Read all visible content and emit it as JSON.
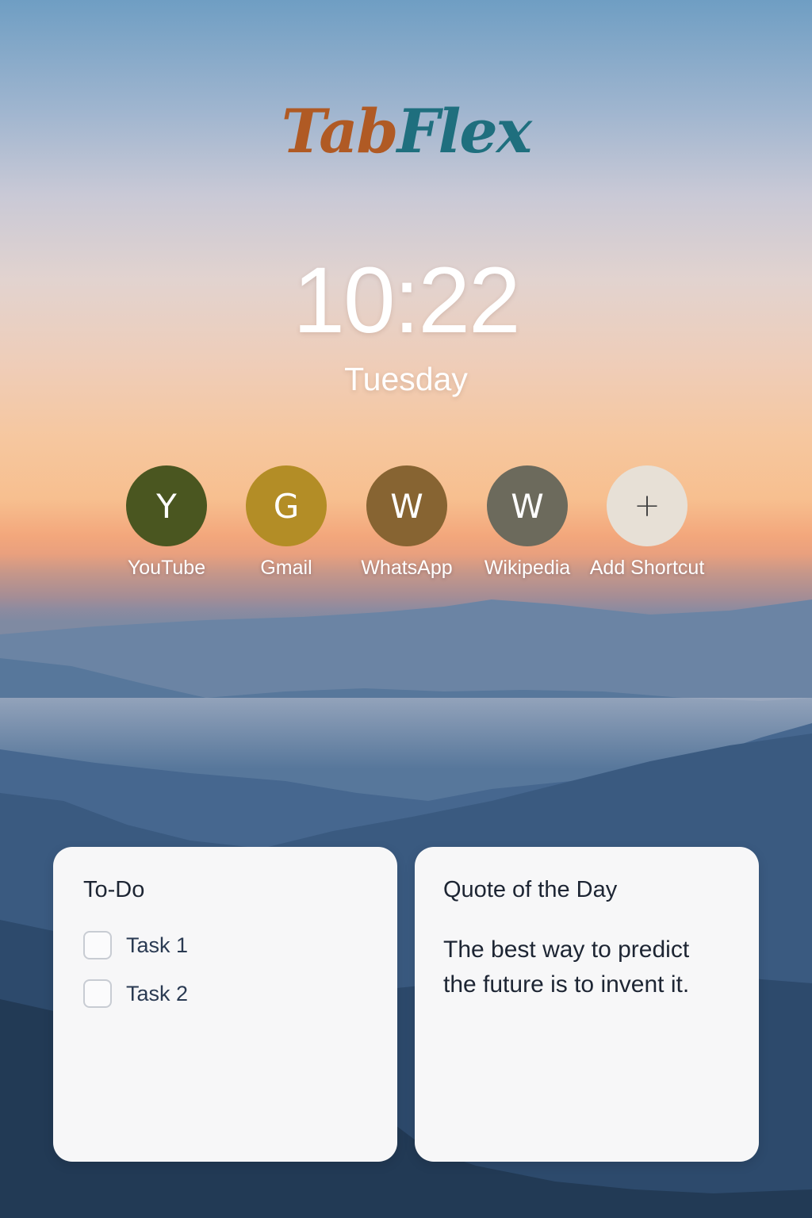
{
  "logo": {
    "part1": "Tab",
    "part2": "Flex"
  },
  "clock": {
    "time": "10:22",
    "day": "Tuesday"
  },
  "shortcuts": [
    {
      "letter": "Y",
      "label": "YouTube",
      "color": "#4a5620"
    },
    {
      "letter": "G",
      "label": "Gmail",
      "color": "#b38d26"
    },
    {
      "letter": "W",
      "label": "WhatsApp",
      "color": "#876432"
    },
    {
      "letter": "W",
      "label": "Wikipedia",
      "color": "#6c6a5c"
    },
    {
      "letter": "+",
      "label": "Add Shortcut",
      "color": "#e7e0d6"
    }
  ],
  "todo": {
    "title": "To-Do",
    "items": [
      {
        "text": "Task 1",
        "checked": false
      },
      {
        "text": "Task 2",
        "checked": false
      }
    ]
  },
  "quote": {
    "title": "Quote of the Day",
    "text": "The best way to predict the future is to invent it."
  }
}
